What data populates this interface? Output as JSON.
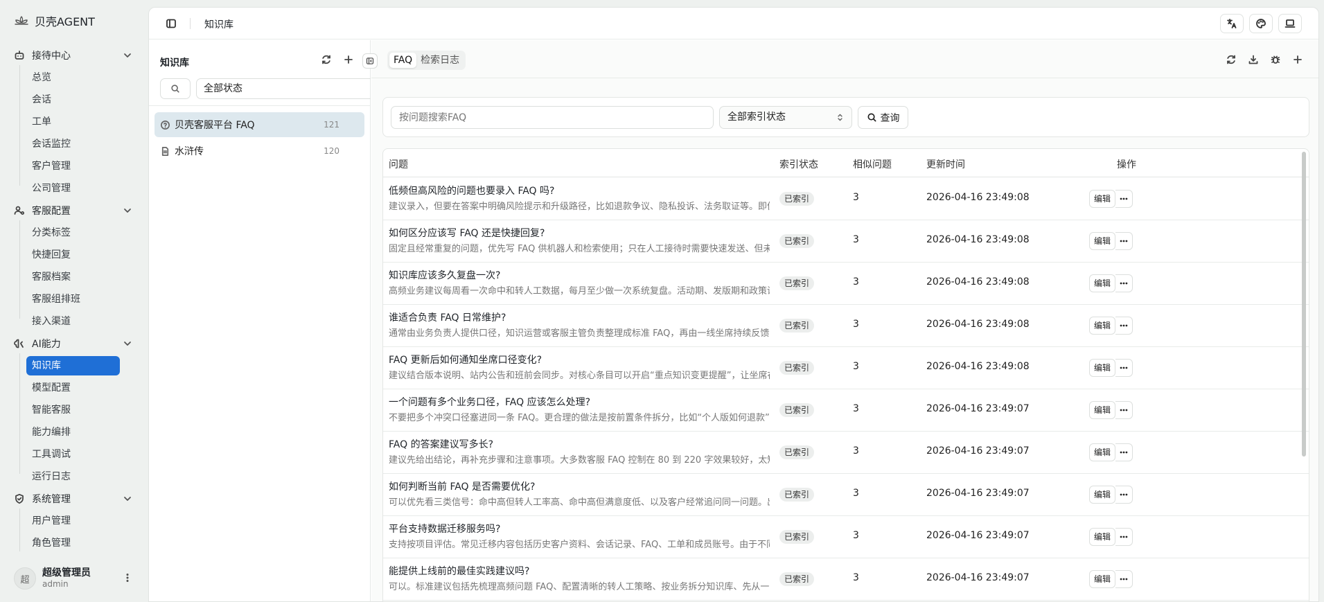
{
  "app": {
    "name": "贝壳AGENT"
  },
  "sidebar": {
    "groups": [
      {
        "label": "接待中心",
        "items": [
          "总览",
          "会话",
          "工单",
          "会话监控",
          "客户管理",
          "公司管理"
        ]
      },
      {
        "label": "客服配置",
        "items": [
          "分类标签",
          "快捷回复",
          "客服档案",
          "客服组排班",
          "接入渠道"
        ]
      },
      {
        "label": "AI能力",
        "items": [
          "知识库",
          "模型配置",
          "智能客服",
          "能力编排",
          "工具调试",
          "运行日志"
        ]
      },
      {
        "label": "系统管理",
        "items": [
          "用户管理",
          "角色管理"
        ]
      }
    ],
    "active_item": "知识库"
  },
  "user": {
    "avatar": "超",
    "name": "超级管理员",
    "role": "admin"
  },
  "topbar": {
    "title": "知识库"
  },
  "kb_panel": {
    "title": "知识库",
    "status_filter": "全部状态",
    "items": [
      {
        "name": "贝壳客服平台 FAQ",
        "count": "121"
      },
      {
        "name": "水浒传",
        "count": "120"
      }
    ]
  },
  "tabs": [
    "FAQ",
    "检索日志"
  ],
  "filter": {
    "search_placeholder": "按问题搜索FAQ",
    "index_status": "全部索引状态",
    "query_label": "查询"
  },
  "table": {
    "headers": {
      "question": "问题",
      "index_status": "索引状态",
      "similar": "相似问题",
      "updated": "更新时间",
      "actions": "操作"
    },
    "edit_label": "编辑",
    "rows": [
      {
        "q": "低频但高风险的问题也要录入 FAQ 吗?",
        "a": "建议录入，但要在答案中明确风险提示和升级路径，比如退款争议、隐私投诉、法务取证等。即便命中率不高",
        "status": "已索引",
        "similar": "3",
        "time": "2026-04-16 23:49:08"
      },
      {
        "q": "如何区分应该写 FAQ 还是快捷回复?",
        "a": "固定且经常重复的问题，优先写 FAQ 供机器人和检索使用；只在人工接待时需要快速发送、但未必适合机器人",
        "status": "已索引",
        "similar": "3",
        "time": "2026-04-16 23:49:08"
      },
      {
        "q": "知识库应该多久复盘一次?",
        "a": "高频业务建议每周看一次命中和转人工数据，每月至少做一次系统复盘。活动期、发版期和政策调整期需要更",
        "status": "已索引",
        "similar": "3",
        "time": "2026-04-16 23:49:08"
      },
      {
        "q": "谁适合负责 FAQ 日常维护?",
        "a": "通常由业务负责人提供口径，知识运营或客服主管负责整理成标准 FAQ，再由一线坐席持续反馈命中和遗漏情",
        "status": "已索引",
        "similar": "3",
        "time": "2026-04-16 23:49:08"
      },
      {
        "q": "FAQ 更新后如何通知坐席口径变化?",
        "a": "建议结合版本说明、站内公告和班前会同步。对核心条目可以开启“重点知识变更提醒”，让坐席在登录后先看",
        "status": "已索引",
        "similar": "3",
        "time": "2026-04-16 23:49:08"
      },
      {
        "q": "一个问题有多个业务口径，FAQ 应该怎么处理?",
        "a": "不要把多个冲突口径塞进同一条 FAQ。更合理的做法是按前置条件拆分，比如“个人版如何退款”和“企业版如",
        "status": "已索引",
        "similar": "3",
        "time": "2026-04-16 23:49:07"
      },
      {
        "q": "FAQ 的答案建议写多长?",
        "a": "建议先给出结论，再补充步骤和注意事项。大多数客服 FAQ 控制在 80 到 220 字效果较好，太短容易信息不",
        "status": "已索引",
        "similar": "3",
        "time": "2026-04-16 23:49:07"
      },
      {
        "q": "如何判断当前 FAQ 是否需要优化?",
        "a": "可以优先看三类信号：命中高但转人工率高、命中高但满意度低、以及客户经常追问同一问题。出现这些情况",
        "status": "已索引",
        "similar": "3",
        "time": "2026-04-16 23:49:07"
      },
      {
        "q": "平台支持数据迁移服务吗?",
        "a": "支持按项目评估。常见迁移内容包括历史客户资料、会话记录、FAQ、工单和成员账号。由于不同系统字段差",
        "status": "已索引",
        "similar": "3",
        "time": "2026-04-16 23:49:07"
      },
      {
        "q": "能提供上线前的最佳实践建议吗?",
        "a": "可以。标准建议包括先梳理高频问题 FAQ、配置清晰的转人工策略、按业务拆分知识库、先从一个渠道灰度上",
        "status": "已索引",
        "similar": "3",
        "time": "2026-04-16 23:49:07"
      }
    ]
  },
  "colors": {
    "accent": "#1f6fd6",
    "selected_kb": "#dde8ee",
    "background": "#eef1ef"
  }
}
